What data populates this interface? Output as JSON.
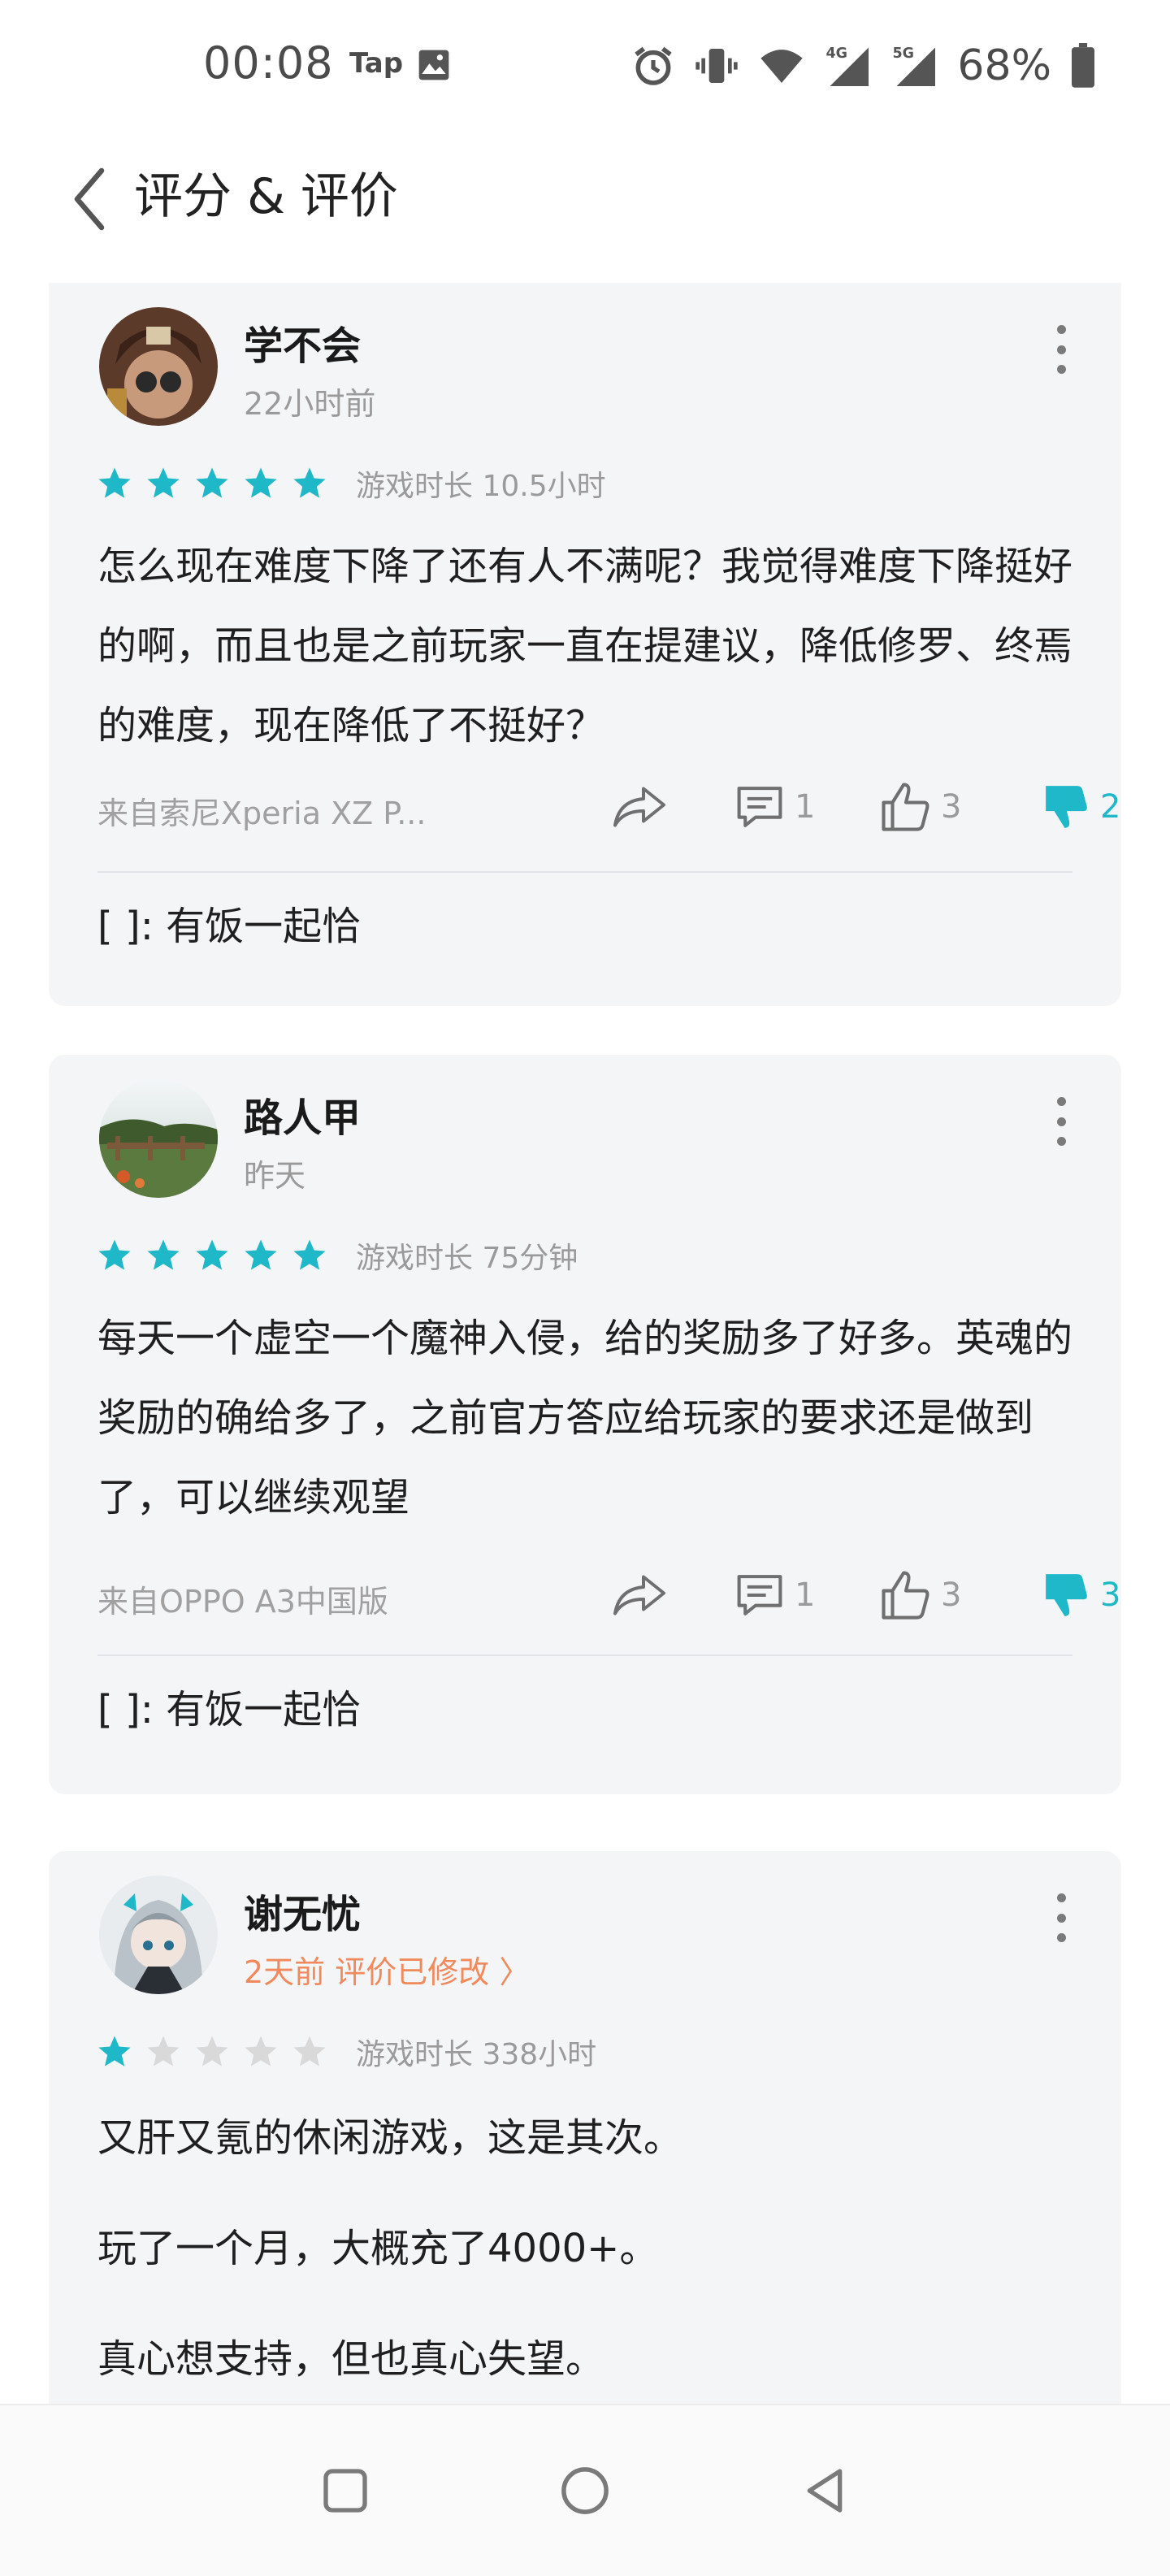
{
  "status_bar": {
    "time": "00:08",
    "tap_label": "Tap",
    "battery_percent": "68%",
    "icons": [
      "image-icon",
      "alarm-icon",
      "vibrate-icon",
      "wifi-icon",
      "signal-4g-icon",
      "signal-5g-icon",
      "battery-icon"
    ],
    "network_4g": "4G",
    "network_5g": "5G"
  },
  "header": {
    "title": "评分 & 评价",
    "back_icon": "chevron-left-icon"
  },
  "colors": {
    "accent": "#1fb8c8",
    "edited": "#f08a5d",
    "card_bg": "#f4f5f7",
    "star_empty": "#d9d9d9"
  },
  "reviews": [
    {
      "user": "学不会",
      "time": "22小时前",
      "rating": 5,
      "play_time": "游戏时长 10.5小时",
      "text": [
        "怎么现在难度下降了还有人不满呢？我觉得难度下降挺好的啊，而且也是之前玩家一直在提建议，降低修罗、终焉的难度，现在降低了不挺好？"
      ],
      "device": "来自索尼Xperia XZ P...",
      "comments": "1",
      "likes": "3",
      "dislikes": "2",
      "reply_bracket": "[      ]",
      "reply_text": ": 有饭一起恰"
    },
    {
      "user": "路人甲",
      "time": "昨天",
      "rating": 5,
      "play_time": "游戏时长 75分钟",
      "text": [
        "每天一个虚空一个魔神入侵，给的奖励多了好多。英魂的奖励的确给多了，之前官方答应给玩家的要求还是做到了，可以继续观望"
      ],
      "device": "来自OPPO A3中国版",
      "comments": "1",
      "likes": "3",
      "dislikes": "3",
      "reply_bracket": "[      ]",
      "reply_text": ": 有饭一起恰"
    },
    {
      "user": "谢无忧",
      "time": "2天前 评价已修改 〉",
      "rating": 1,
      "play_time": "游戏时长 338小时",
      "text": [
        "又肝又氪的休闲游戏，这是其次。",
        "玩了一个月，大概充了4000+。",
        "真心想支持，但也真心失望。"
      ]
    }
  ],
  "nav_bar": {
    "buttons": [
      "recents-icon",
      "home-icon",
      "back-icon"
    ]
  }
}
